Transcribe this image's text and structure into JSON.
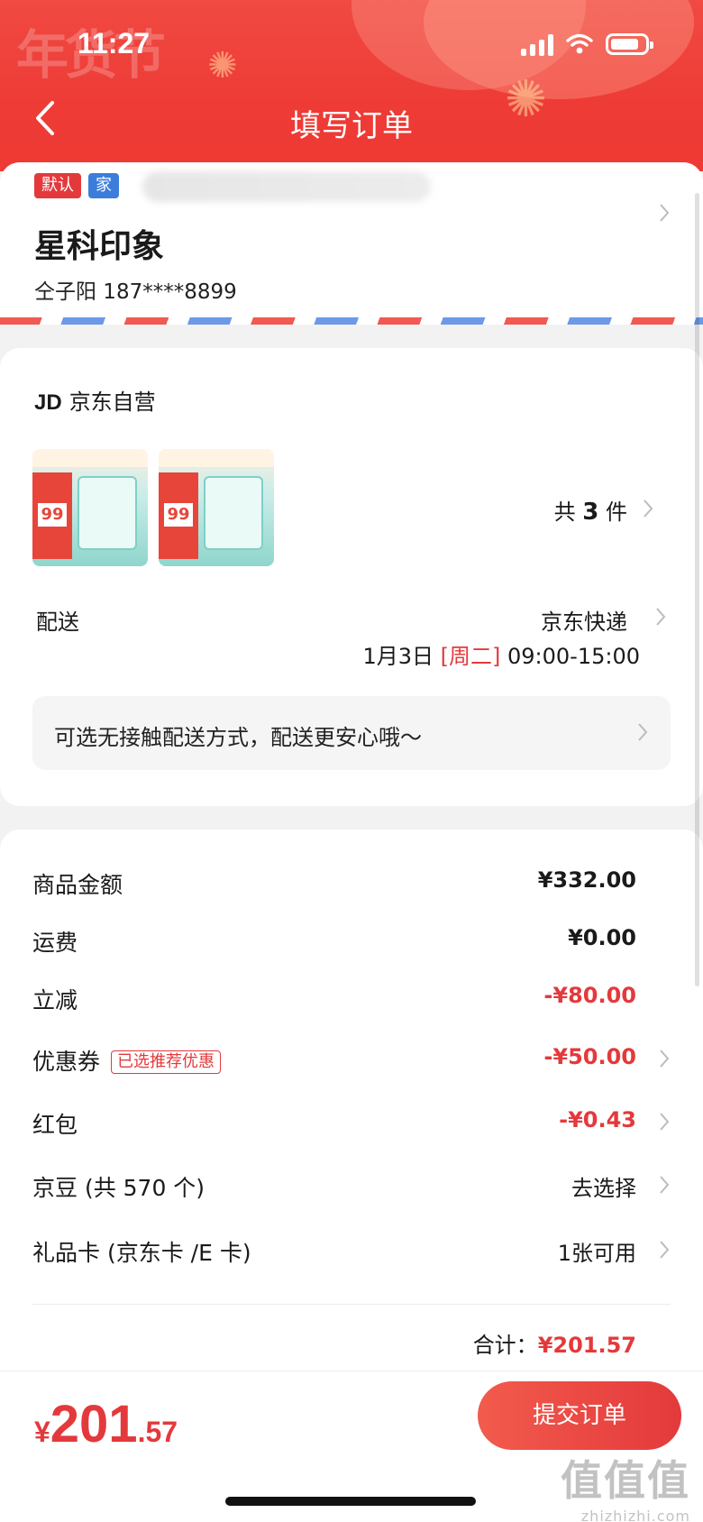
{
  "status_bar": {
    "time": "11:27"
  },
  "header": {
    "title": "填写订单",
    "deco_text": "年货节"
  },
  "address": {
    "default_tag": "默认",
    "home_tag": "家",
    "name": "星科印象",
    "contact": "仝子阳  187****8899"
  },
  "shop": {
    "logo": "JD",
    "name": "京东自营",
    "product_thumb_price": "99",
    "quantity_prefix": "共",
    "quantity": "3",
    "quantity_suffix": "件",
    "delivery_label": "配送",
    "delivery_method": "京东快递",
    "delivery_date": "1月3日",
    "delivery_weekday": "[周二]",
    "delivery_window": "09:00-15:00",
    "notice": "可选无接触配送方式，配送更安心哦～"
  },
  "price_rows": [
    {
      "label": "商品金额",
      "value": "¥332.00"
    },
    {
      "label": "运费",
      "value": "¥0.00"
    },
    {
      "label": "立减",
      "value": "-¥80.00"
    },
    {
      "label": "优惠券",
      "tag": "已选推荐优惠",
      "value": "-¥50.00"
    },
    {
      "label": "红包",
      "value": "-¥0.43"
    },
    {
      "label": "京豆 (共 570 个)",
      "value": "去选择"
    },
    {
      "label": "礼品卡 (京东卡 /E 卡)",
      "value": "1张可用"
    }
  ],
  "total": {
    "label": "合计：",
    "amount": "¥201.57"
  },
  "bottom": {
    "currency": "¥",
    "price_int": "201",
    "price_dec": ".57",
    "submit_label": "提交订单",
    "watermark_main": "值值值",
    "watermark_sub": "zhizhizhi.com"
  },
  "colors": {
    "brand_red": "#e4393c",
    "header_red": "#ef3a33",
    "tag_blue": "#3c7ddc"
  }
}
